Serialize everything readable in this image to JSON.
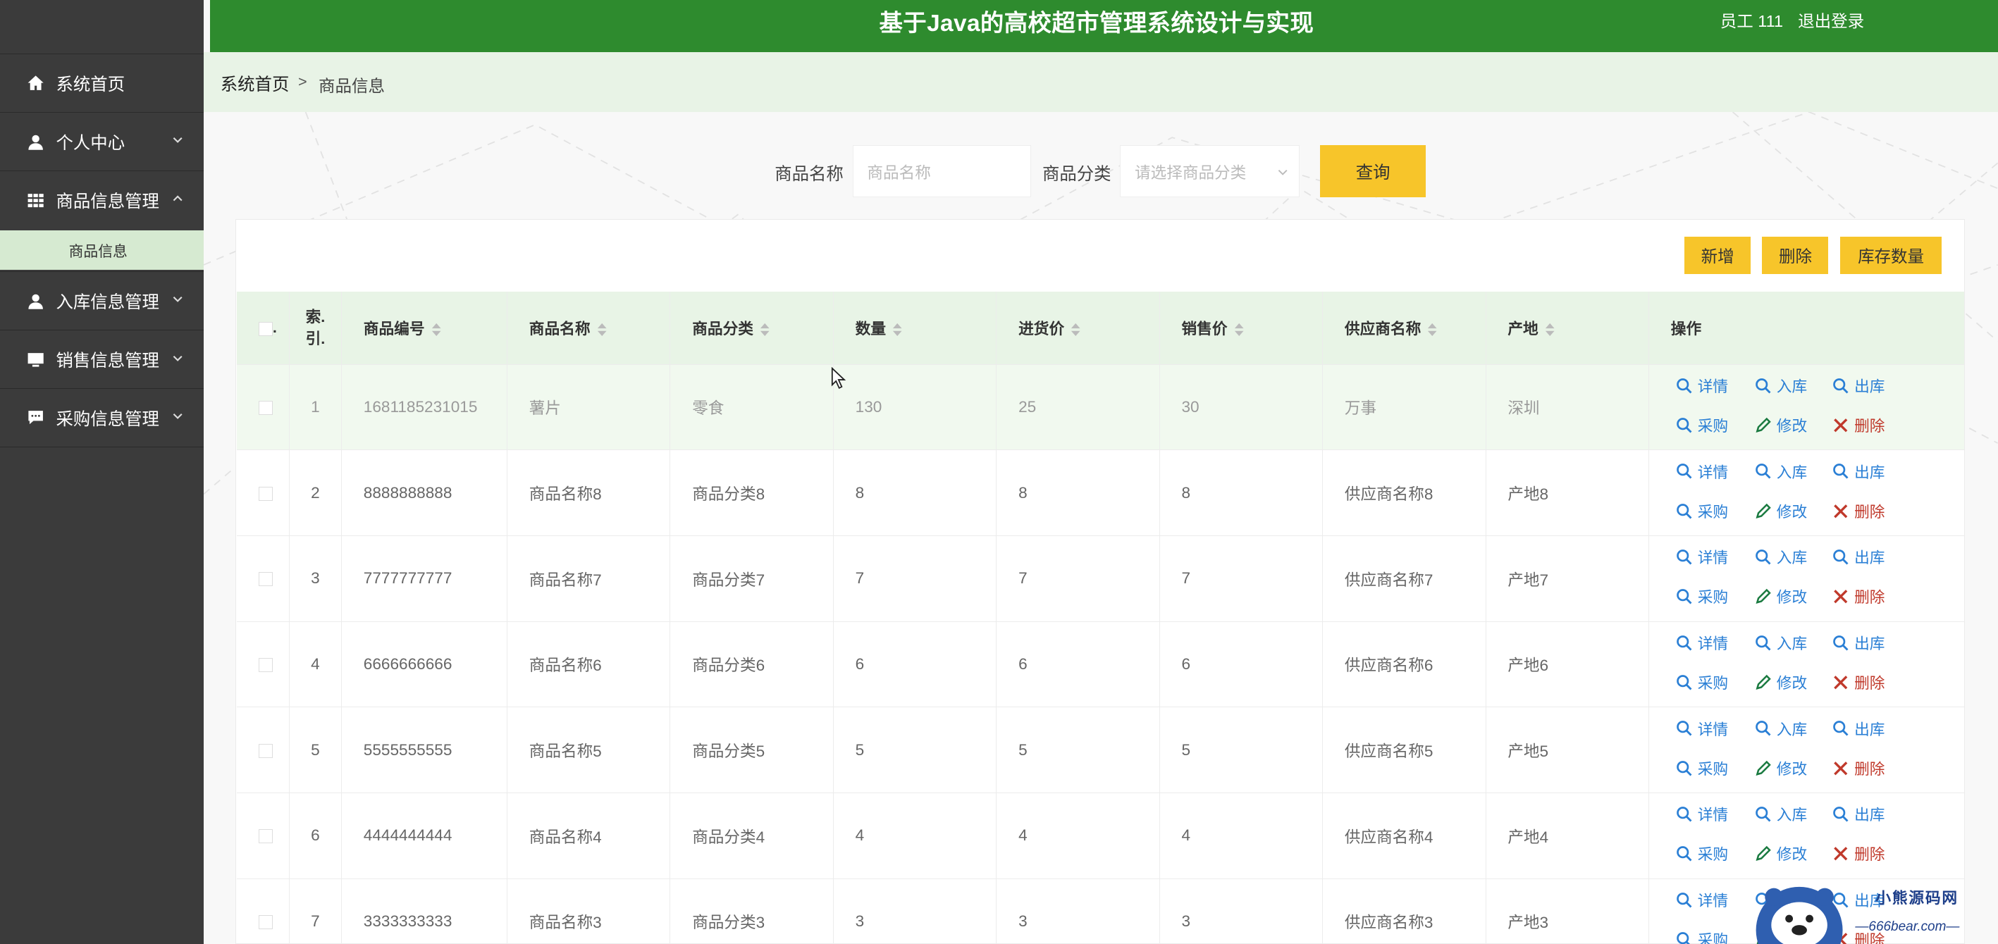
{
  "app": {
    "title": "基于Java的高校超市管理系统设计与实现",
    "user": "员工 111",
    "logout": "退出登录"
  },
  "sidebar": {
    "items": [
      {
        "label": "系统首页",
        "icon": "home-icon"
      },
      {
        "label": "个人中心",
        "icon": "user-icon"
      },
      {
        "label": "商品信息管理",
        "icon": "grid-icon"
      },
      {
        "label": "入库信息管理",
        "icon": "user-icon"
      },
      {
        "label": "销售信息管理",
        "icon": "monitor-icon"
      },
      {
        "label": "采购信息管理",
        "icon": "chat-icon"
      }
    ],
    "sub_item": "商品信息"
  },
  "breadcrumb": {
    "home": "系统首页",
    "separator": ">",
    "current": "商品信息"
  },
  "search": {
    "name_label": "商品名称",
    "name_placeholder": "商品名称",
    "category_label": "商品分类",
    "category_placeholder": "请选择商品分类",
    "query_button": "查询"
  },
  "toolbar": {
    "add": "新增",
    "delete": "删除",
    "stock": "库存数量"
  },
  "table": {
    "headers": {
      "index": "索引.",
      "index_line1": "索.",
      "index_line2": "引.",
      "check_label": ".",
      "code": "商品编号",
      "name": "商品名称",
      "category": "商品分类",
      "qty": "数量",
      "purchase_price": "进货价",
      "sale_price": "销售价",
      "supplier": "供应商名称",
      "origin": "产地",
      "actions": "操作"
    },
    "actions": {
      "detail": "详情",
      "in": "入库",
      "out": "出库",
      "purchase": "采购",
      "edit": "修改",
      "remove": "删除"
    },
    "rows": [
      {
        "idx": "1",
        "code": "1681185231015",
        "name": "薯片",
        "category": "零食",
        "qty": "130",
        "pp": "25",
        "sp": "30",
        "supplier": "万事",
        "origin": "深圳"
      },
      {
        "idx": "2",
        "code": "8888888888",
        "name": "商品名称8",
        "category": "商品分类8",
        "qty": "8",
        "pp": "8",
        "sp": "8",
        "supplier": "供应商名称8",
        "origin": "产地8"
      },
      {
        "idx": "3",
        "code": "7777777777",
        "name": "商品名称7",
        "category": "商品分类7",
        "qty": "7",
        "pp": "7",
        "sp": "7",
        "supplier": "供应商名称7",
        "origin": "产地7"
      },
      {
        "idx": "4",
        "code": "6666666666",
        "name": "商品名称6",
        "category": "商品分类6",
        "qty": "6",
        "pp": "6",
        "sp": "6",
        "supplier": "供应商名称6",
        "origin": "产地6"
      },
      {
        "idx": "5",
        "code": "5555555555",
        "name": "商品名称5",
        "category": "商品分类5",
        "qty": "5",
        "pp": "5",
        "sp": "5",
        "supplier": "供应商名称5",
        "origin": "产地5"
      },
      {
        "idx": "6",
        "code": "4444444444",
        "name": "商品名称4",
        "category": "商品分类4",
        "qty": "4",
        "pp": "4",
        "sp": "4",
        "supplier": "供应商名称4",
        "origin": "产地4"
      },
      {
        "idx": "7",
        "code": "3333333333",
        "name": "商品名称3",
        "category": "商品分类3",
        "qty": "3",
        "pp": "3",
        "sp": "3",
        "supplier": "供应商名称3",
        "origin": "产地3"
      }
    ]
  },
  "watermark": {
    "line1": "小熊源码网",
    "line2": "—666bear.com—"
  },
  "colors": {
    "header": "#2e8b2e",
    "sidebar": "#3b3b3b",
    "accent_yellow": "#f7c52a",
    "link_blue": "#2a7fd5",
    "delete_red": "#c0392b"
  }
}
